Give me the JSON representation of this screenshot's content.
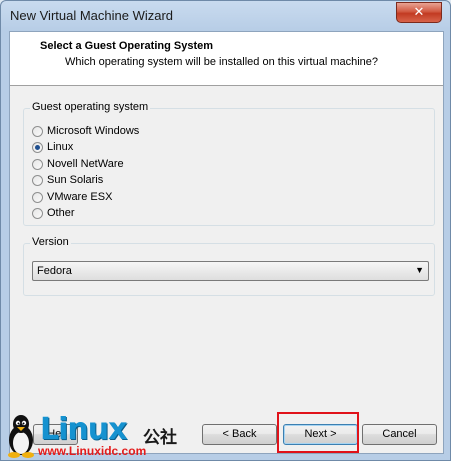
{
  "window": {
    "title": "New Virtual Machine Wizard",
    "close_symbol": "✕"
  },
  "header": {
    "title": "Select a Guest Operating System",
    "subtitle": "Which operating system will be installed on this virtual machine?"
  },
  "guest_os": {
    "label": "Guest operating system",
    "options": [
      {
        "label": "Microsoft Windows",
        "checked": false
      },
      {
        "label": "Linux",
        "checked": true
      },
      {
        "label": "Novell NetWare",
        "checked": false
      },
      {
        "label": "Sun Solaris",
        "checked": false
      },
      {
        "label": "VMware ESX",
        "checked": false
      },
      {
        "label": "Other",
        "checked": false
      }
    ]
  },
  "version": {
    "label": "Version",
    "selected": "Fedora"
  },
  "buttons": {
    "help": "Hel",
    "back": "< Back",
    "next": "Next >",
    "cancel": "Cancel"
  },
  "watermark": {
    "brand": "Linux",
    "cn": "公社",
    "url": "www.Linuxidc.com"
  },
  "colors": {
    "highlight": "#e0121a",
    "brand": "#1592d0"
  }
}
